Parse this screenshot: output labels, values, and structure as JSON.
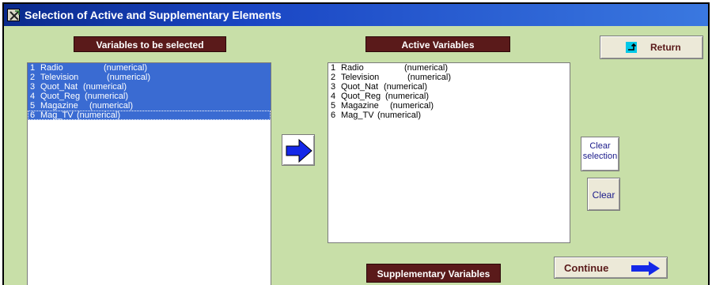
{
  "window": {
    "title": "Selection of Active and Supplementary Elements"
  },
  "colors": {
    "background": "#c8dfa8",
    "title_bar": "#1a46c4",
    "header": "#5a1a1a",
    "selection": "#3a6bd2",
    "arrow": "#1428e8"
  },
  "left_panel": {
    "header": "Variables to be selected",
    "items": [
      {
        "num": "1",
        "name": "Radio",
        "type": "(numerical)"
      },
      {
        "num": "2",
        "name": "Television",
        "type": "(numerical)"
      },
      {
        "num": "3",
        "name": "Quot_Nat",
        "type": "(numerical)"
      },
      {
        "num": "4",
        "name": "Quot_Reg",
        "type": "(numerical)"
      },
      {
        "num": "5",
        "name": "Magazine",
        "type": "(numerical)"
      },
      {
        "num": "6",
        "name": "Mag_TV",
        "type": "(numerical)"
      }
    ]
  },
  "active_panel": {
    "header": "Active Variables",
    "items": [
      {
        "num": "1",
        "name": "Radio",
        "type": "(numerical)"
      },
      {
        "num": "2",
        "name": "Television",
        "type": "(numerical)"
      },
      {
        "num": "3",
        "name": "Quot_Nat",
        "type": "(numerical)"
      },
      {
        "num": "4",
        "name": "Quot_Reg",
        "type": "(numerical)"
      },
      {
        "num": "5",
        "name": "Magazine",
        "type": "(numerical)"
      },
      {
        "num": "6",
        "name": "Mag_TV",
        "type": "(numerical)"
      }
    ]
  },
  "supplementary_panel": {
    "header": "Supplementary Variables"
  },
  "buttons": {
    "transfer_icon": "right-arrow-icon",
    "return_label": "Return",
    "return_icon": "return-arrow-icon",
    "clear_selection_line1": "Clear",
    "clear_selection_line2": "selection",
    "clear_label": "Clear",
    "continue_label": "Continue",
    "continue_icon": "right-arrow-icon"
  }
}
